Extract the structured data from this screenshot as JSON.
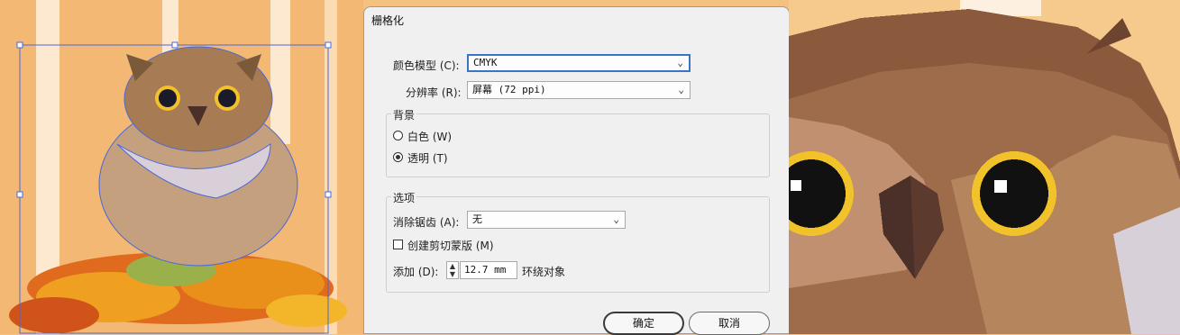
{
  "dialog": {
    "title": "栅格化",
    "color_model": {
      "label": "颜色模型 (C):",
      "value": "CMYK"
    },
    "resolution": {
      "label": "分辨率 (R):",
      "value": "屏幕 (72 ppi)"
    },
    "background": {
      "title": "背景",
      "options": [
        {
          "label": "白色 (W)",
          "selected": false
        },
        {
          "label": "透明 (T)",
          "selected": true
        }
      ]
    },
    "options": {
      "title": "选项",
      "antialias": {
        "label": "消除锯齿 (A):",
        "value": "无"
      },
      "clipping_mask": {
        "label": "创建剪切蒙版 (M)",
        "checked": false
      },
      "add": {
        "label": "添加 (D):",
        "value": "12.7 mm",
        "suffix": "环绕对象"
      }
    },
    "ok_label": "确定",
    "cancel_label": "取消"
  },
  "colors": {
    "bg_orange": "#f4bd78",
    "owl_brown": "#8b5a3c",
    "owl_light": "#c09070",
    "eye_yellow": "#f2c22a",
    "selection_blue": "#4a68d8",
    "dialog_bg": "#f0f0f0",
    "focus_blue": "#3a74c4"
  }
}
